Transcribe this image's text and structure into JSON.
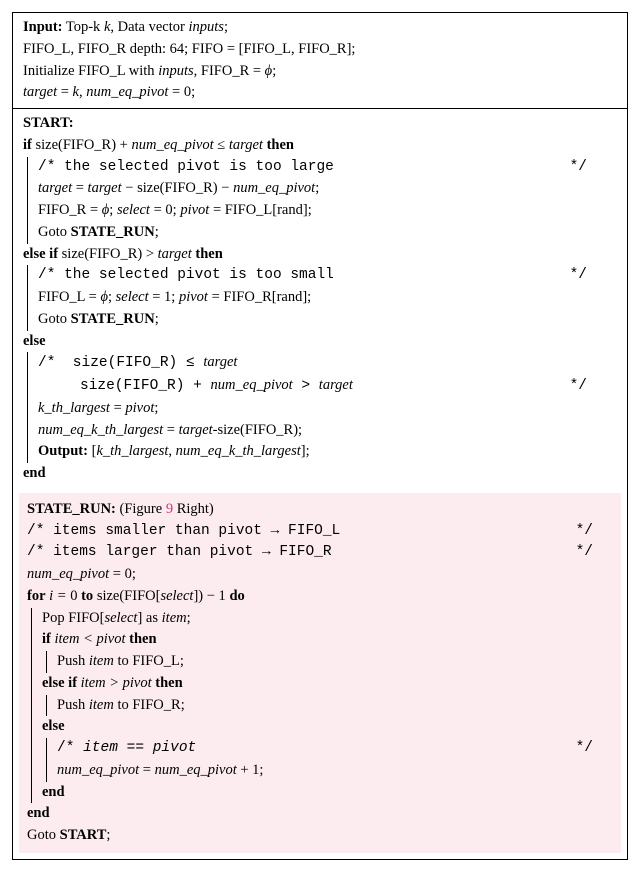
{
  "input": {
    "label": "Input:",
    "l1a": "Top-k ",
    "l1b": "k",
    "l1c": ", Data vector ",
    "l1d": "inputs",
    "l1e": ";",
    "l2": "FIFO_L, FIFO_R depth: 64; FIFO = [FIFO_L, FIFO_R];",
    "l3a": "Initialize FIFO_L with ",
    "l3b": "inputs",
    "l3c": ", FIFO_R = ",
    "l3d": "ϕ",
    "l3e": ";",
    "l4a": "target",
    "l4b": " = ",
    "l4c": "k",
    "l4d": ", ",
    "l4e": "num_eq_pivot",
    "l4f": " = 0;"
  },
  "start": {
    "label": "START:",
    "if_a": "if",
    "if_b": " size(FIFO_R) + ",
    "if_c": "num_eq_pivot",
    "if_d": " ≤ ",
    "if_e": "target ",
    "if_f": "then",
    "c1_open": "/* ",
    "c1_body": "the selected pivot is too large",
    "c1_close": "*/",
    "s1a": "target",
    "s1b": " = ",
    "s1c": "target",
    "s1d": " − size(FIFO_R) − ",
    "s1e": "num_eq_pivot",
    "s1f": ";",
    "s2a": "FIFO_R = ",
    "s2b": "ϕ",
    "s2c": "; ",
    "s2d": "select",
    "s2e": " = 0; ",
    "s2f": "pivot",
    "s2g": " = FIFO_L[rand];",
    "s3a": "Goto ",
    "s3b": "STATE_RUN",
    "s3c": ";",
    "elif_a": "else if",
    "elif_b": " size(FIFO_R) > ",
    "elif_c": "target ",
    "elif_d": "then",
    "c2_open": "/* ",
    "c2_body": "the selected pivot is too small",
    "c2_close": "*/",
    "s4a": "FIFO_L = ",
    "s4b": "ϕ",
    "s4c": "; ",
    "s4d": "select",
    "s4e": " = 1; ",
    "s4f": "pivot",
    "s4g": " = FIFO_R[rand];",
    "s5a": "Goto ",
    "s5b": "STATE_RUN",
    "s5c": ";",
    "else": "else",
    "c3_open": "/*",
    "c3_l1a": " size(FIFO_R) ≤ ",
    "c3_l1b": "target",
    "c3_l2a": "size(FIFO_R) + ",
    "c3_l2b": "num_eq_pivot",
    "c3_l2c": " > ",
    "c3_l2d": "target",
    "c3_close": "*/",
    "s6a": "k_th_largest",
    "s6b": " = ",
    "s6c": "pivot",
    "s6d": ";",
    "s7a": "num_eq_k_th_largest",
    "s7b": " = ",
    "s7c": "target",
    "s7d": "-size(FIFO_R);",
    "out_a": "Output:",
    "out_b": " [",
    "out_c": "k_th_largest",
    "out_d": ", ",
    "out_e": "num_eq_k_th_largest",
    "out_f": "];",
    "end": "end"
  },
  "run": {
    "title_a": "STATE_RUN:",
    "title_b": " (Figure ",
    "title_c": "9",
    "title_d": " Right)",
    "c1_open": "/* ",
    "c1_body": "items smaller than pivot → FIFO_L",
    "c1_close": "*/",
    "c2_open": "/* ",
    "c2_body": "items larger than pivot → FIFO_R",
    "c2_close": "*/",
    "l1a": "num_eq_pivot",
    "l1b": " = 0;",
    "for_a": "for",
    "for_b": " i = ",
    "for_c": "0 ",
    "for_d": "to",
    "for_e": " size(FIFO[",
    "for_f": "select",
    "for_g": "]) − 1 ",
    "for_h": "do",
    "p1a": "Pop FIFO[",
    "p1b": "select",
    "p1c": "] as ",
    "p1d": "item",
    "p1e": ";",
    "if_a": "if",
    "if_b": " item < pivot ",
    "if_c": "then",
    "push_l_a": "Push ",
    "push_l_b": "item",
    "push_l_c": " to FIFO_L;",
    "elif_a": "else if",
    "elif_b": " item > pivot ",
    "elif_c": "then",
    "push_r_a": "Push ",
    "push_r_b": "item",
    "push_r_c": " to FIFO_R;",
    "else": "else",
    "c3_open": "/* ",
    "c3_body": "item == pivot",
    "c3_close": "*/",
    "inc_a": "num_eq_pivot",
    "inc_b": " = ",
    "inc_c": "num_eq_pivot",
    "inc_d": " + 1;",
    "end1": "end",
    "end2": "end",
    "goto_a": "Goto ",
    "goto_b": "START",
    "goto_c": ";"
  }
}
